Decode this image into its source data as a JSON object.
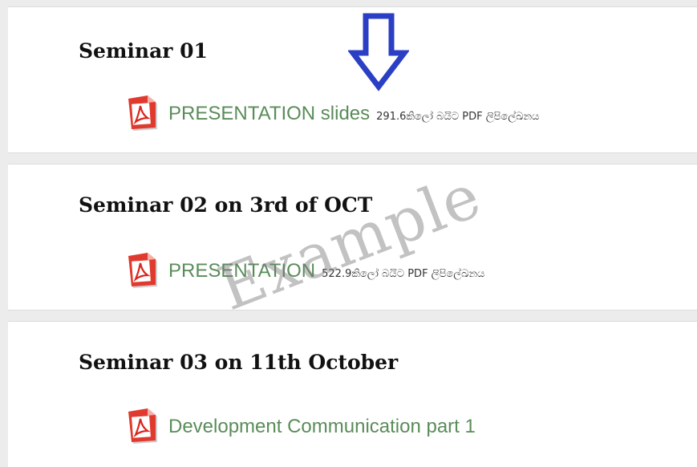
{
  "sections": [
    {
      "title": "Seminar 01",
      "resource": {
        "icon": "pdf-icon",
        "link_text": "PRESENTATION slides",
        "meta": "291.6කිලෝ බයිට PDF ලිපිලේඛනය"
      }
    },
    {
      "title": "Seminar 02 on 3rd of OCT",
      "resource": {
        "icon": "pdf-icon",
        "link_text": "PRESENTATION",
        "meta": "522.9කිලෝ බයිට PDF ලිපිලේඛනය"
      }
    },
    {
      "title": "Seminar 03 on 11th October",
      "resource": {
        "icon": "pdf-icon",
        "link_text": "Development Communication part 1",
        "meta": ""
      }
    }
  ],
  "annotation": {
    "arrow_icon": "down-arrow-icon",
    "arrow_color": "#2b3fc4",
    "watermark_text": "Example"
  },
  "colors": {
    "link": "#5a8c5a",
    "pdf_red": "#d9261c"
  }
}
